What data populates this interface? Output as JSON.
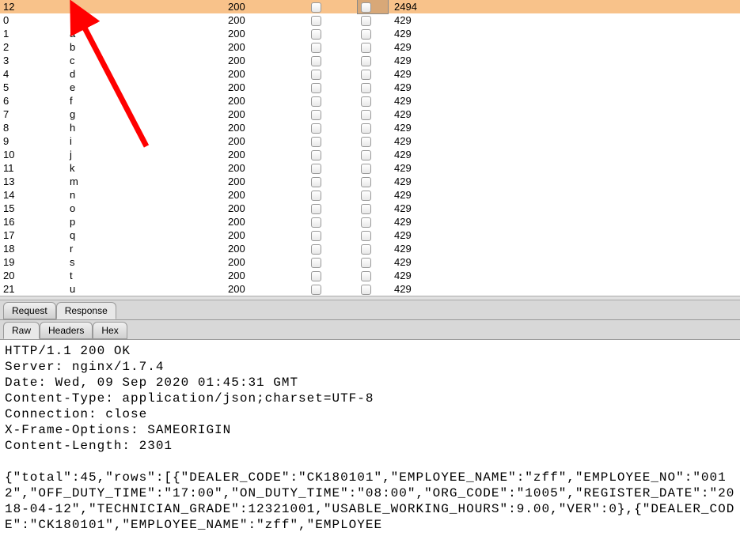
{
  "table": {
    "highlight_index": 0,
    "rows": [
      {
        "id": "12",
        "payload": "l",
        "status": "200",
        "len": "2494"
      },
      {
        "id": "0",
        "payload": "",
        "status": "200",
        "len": "429"
      },
      {
        "id": "1",
        "payload": "a",
        "status": "200",
        "len": "429"
      },
      {
        "id": "2",
        "payload": "b",
        "status": "200",
        "len": "429"
      },
      {
        "id": "3",
        "payload": "c",
        "status": "200",
        "len": "429"
      },
      {
        "id": "4",
        "payload": "d",
        "status": "200",
        "len": "429"
      },
      {
        "id": "5",
        "payload": "e",
        "status": "200",
        "len": "429"
      },
      {
        "id": "6",
        "payload": "f",
        "status": "200",
        "len": "429"
      },
      {
        "id": "7",
        "payload": "g",
        "status": "200",
        "len": "429"
      },
      {
        "id": "8",
        "payload": "h",
        "status": "200",
        "len": "429"
      },
      {
        "id": "9",
        "payload": "i",
        "status": "200",
        "len": "429"
      },
      {
        "id": "10",
        "payload": "j",
        "status": "200",
        "len": "429"
      },
      {
        "id": "11",
        "payload": "k",
        "status": "200",
        "len": "429"
      },
      {
        "id": "13",
        "payload": "m",
        "status": "200",
        "len": "429"
      },
      {
        "id": "14",
        "payload": "n",
        "status": "200",
        "len": "429"
      },
      {
        "id": "15",
        "payload": "o",
        "status": "200",
        "len": "429"
      },
      {
        "id": "16",
        "payload": "p",
        "status": "200",
        "len": "429"
      },
      {
        "id": "17",
        "payload": "q",
        "status": "200",
        "len": "429"
      },
      {
        "id": "18",
        "payload": "r",
        "status": "200",
        "len": "429"
      },
      {
        "id": "19",
        "payload": "s",
        "status": "200",
        "len": "429"
      },
      {
        "id": "20",
        "payload": "t",
        "status": "200",
        "len": "429"
      },
      {
        "id": "21",
        "payload": "u",
        "status": "200",
        "len": "429"
      }
    ]
  },
  "tabs_main": {
    "request": "Request",
    "response": "Response",
    "active": "response"
  },
  "tabs_sub": {
    "raw": "Raw",
    "headers": "Headers",
    "hex": "Hex",
    "active": "raw"
  },
  "response_text": "HTTP/1.1 200 OK\nServer: nginx/1.7.4\nDate: Wed, 09 Sep 2020 01:45:31 GMT\nContent-Type: application/json;charset=UTF-8\nConnection: close\nX-Frame-Options: SAMEORIGIN\nContent-Length: 2301\n\n{\"total\":45,\"rows\":[{\"DEALER_CODE\":\"CK180101\",\"EMPLOYEE_NAME\":\"zff\",\"EMPLOYEE_NO\":\"0012\",\"OFF_DUTY_TIME\":\"17:00\",\"ON_DUTY_TIME\":\"08:00\",\"ORG_CODE\":\"1005\",\"REGISTER_DATE\":\"2018-04-12\",\"TECHNICIAN_GRADE\":12321001,\"USABLE_WORKING_HOURS\":9.00,\"VER\":0},{\"DEALER_CODE\":\"CK180101\",\"EMPLOYEE_NAME\":\"zff\",\"EMPLOYEE",
  "annotation": {
    "type": "arrow",
    "color": "#ff0000"
  }
}
